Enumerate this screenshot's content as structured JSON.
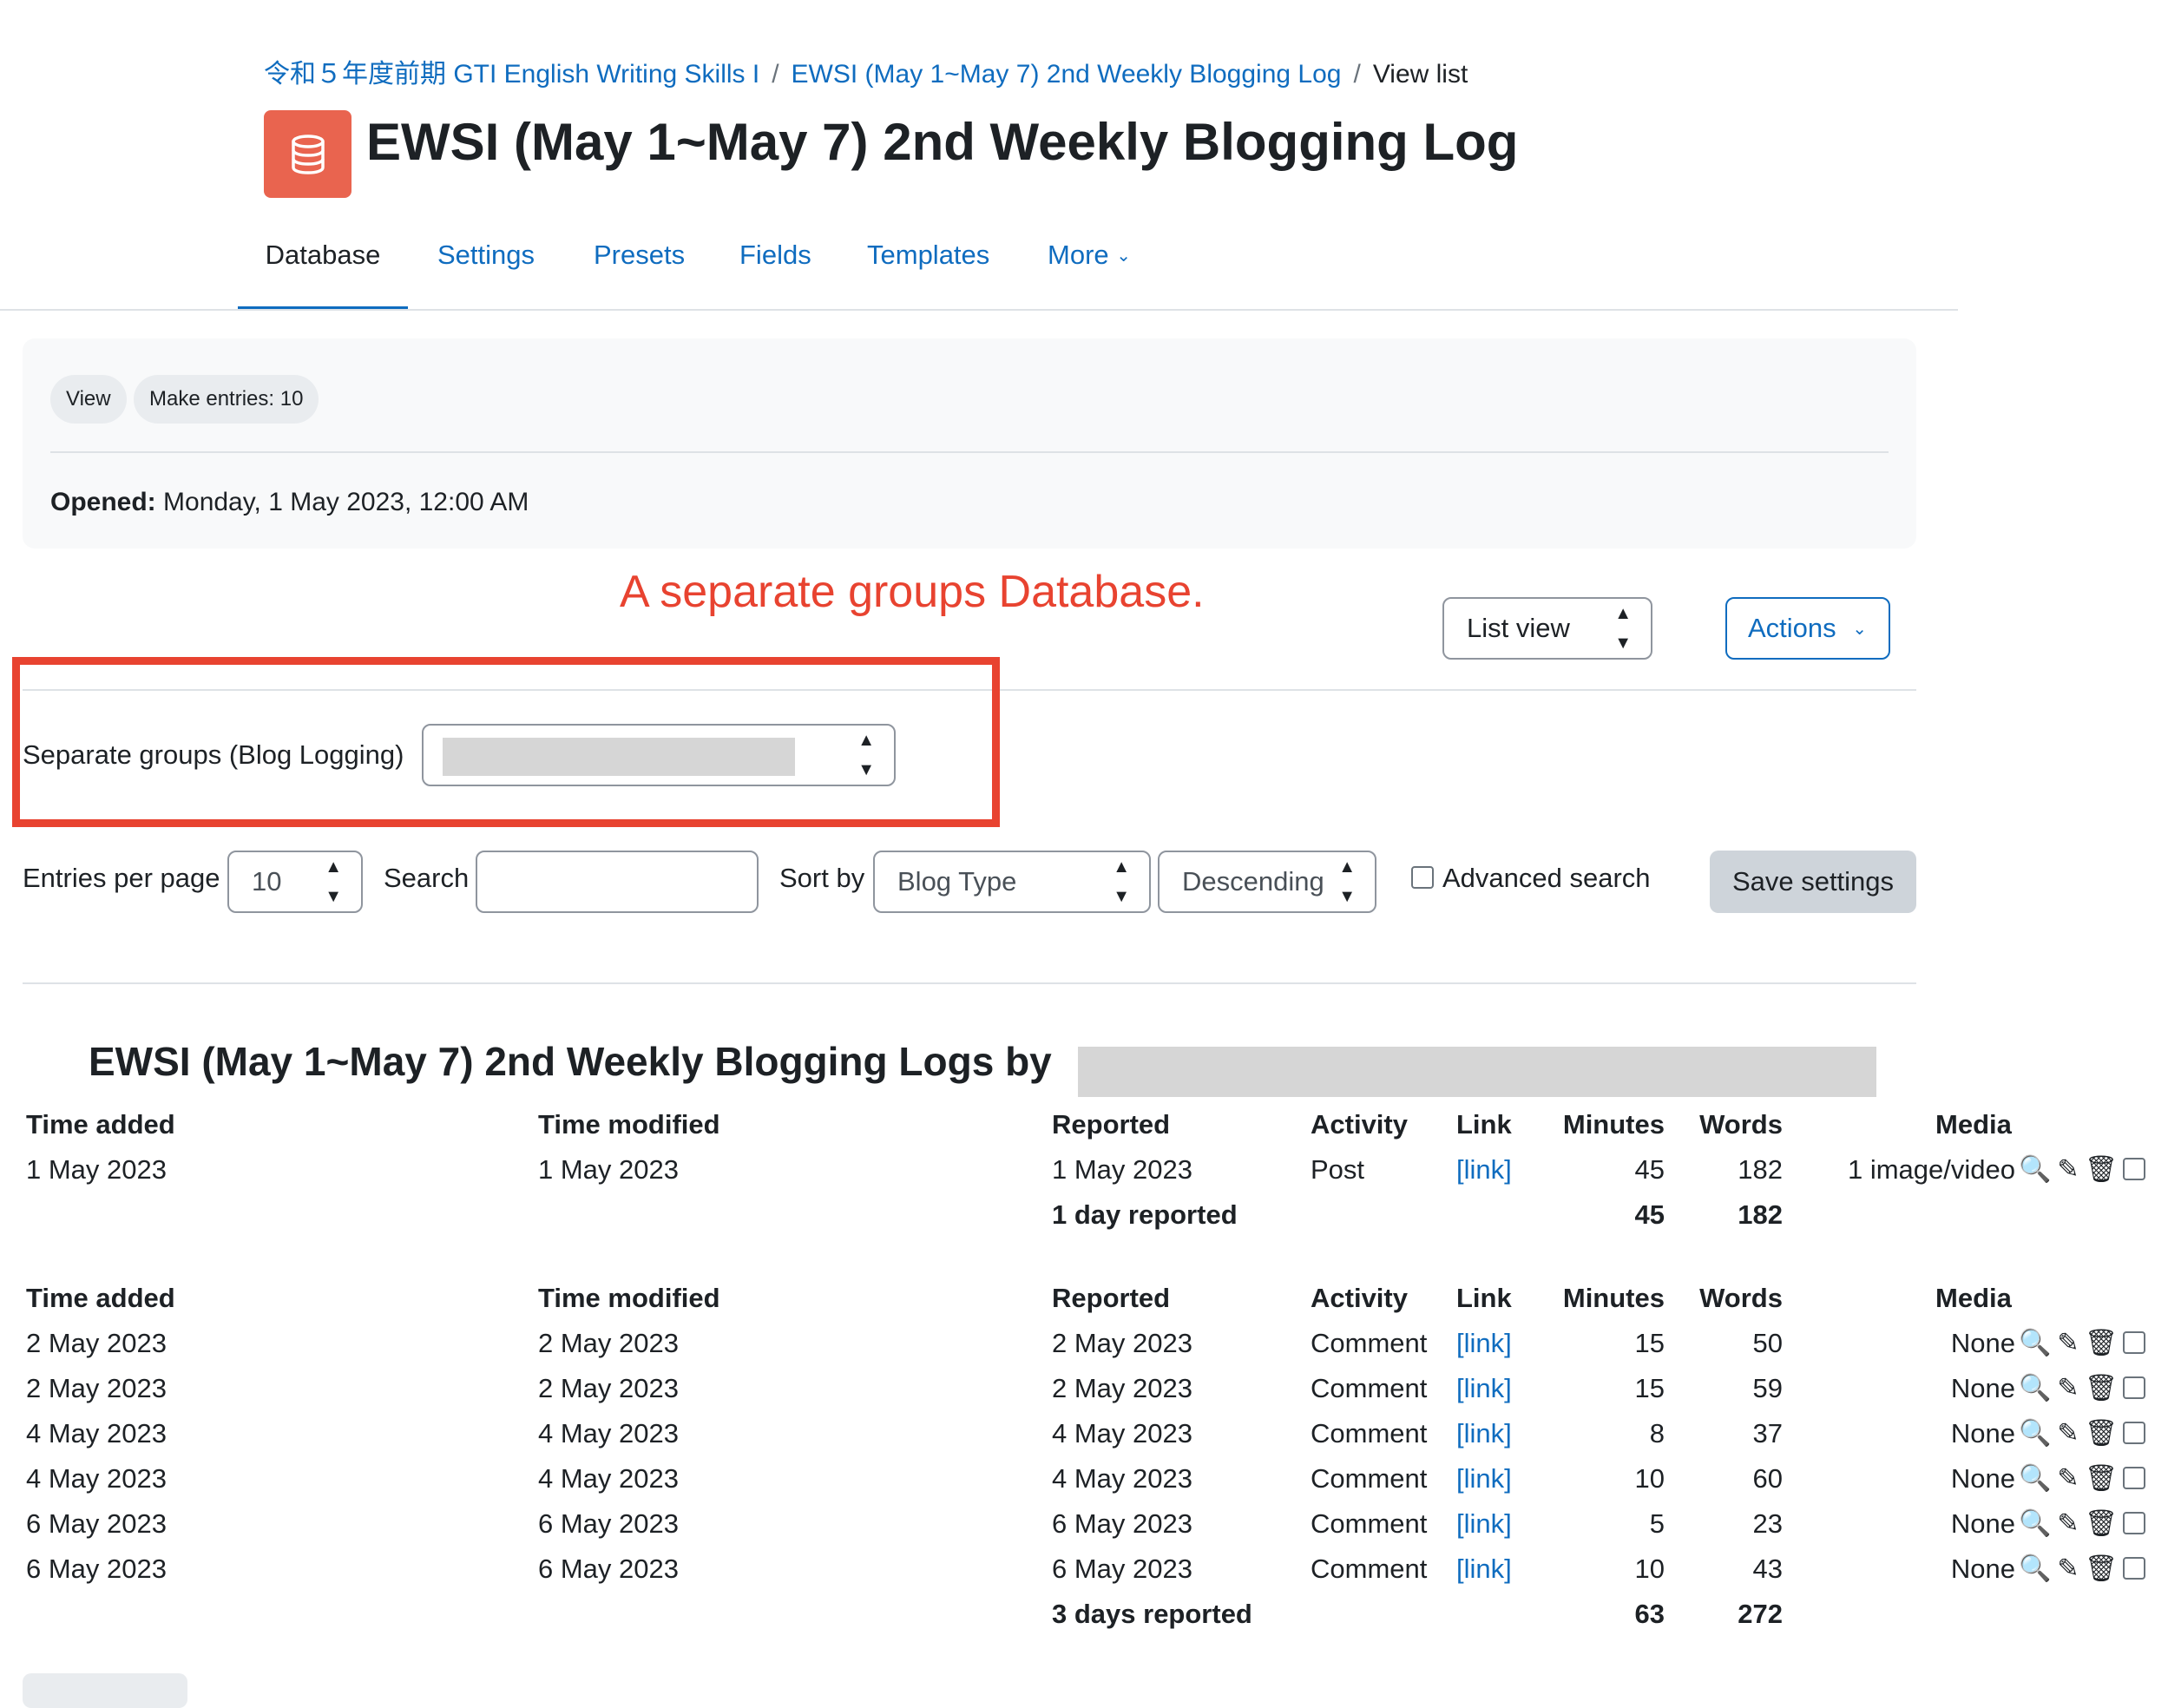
{
  "breadcrumb": {
    "course": "令和５年度前期 GTI English Writing Skills I",
    "activity": "EWSI (May 1~May 7) 2nd Weekly Blogging Log",
    "current": "View list",
    "separator": "/"
  },
  "header": {
    "title": "EWSI (May 1~May 7) 2nd Weekly Blogging Log",
    "icon": "database-icon",
    "icon_color": "#e9644f"
  },
  "nav": {
    "tabs": [
      "Database",
      "Settings",
      "Presets",
      "Fields",
      "Templates",
      "More"
    ],
    "active": "Database"
  },
  "info": {
    "pills": [
      "View",
      "Make entries: 10"
    ],
    "opened_label": "Opened:",
    "opened_value": "Monday, 1 May 2023, 12:00 AM"
  },
  "annotation": {
    "text": "A separate groups Database.",
    "color": "#e84330"
  },
  "view_select": {
    "value": "List view"
  },
  "actions_button": {
    "label": "Actions"
  },
  "groups": {
    "label": "Separate groups (Blog Logging)",
    "value": ""
  },
  "controls": {
    "entries_label": "Entries per page",
    "entries_value": "10",
    "search_label": "Search",
    "search_value": "",
    "sort_label": "Sort by",
    "sort_value": "Blog Type",
    "order_value": "Descending",
    "advanced_label": "Advanced search",
    "save_label": "Save settings"
  },
  "list": {
    "title": "EWSI (May 1~May 7) 2nd Weekly Blogging Logs by"
  },
  "table": {
    "headers": [
      "Time added",
      "Time modified",
      "Reported",
      "Activity",
      "Link",
      "Minutes",
      "Words",
      "Media"
    ],
    "groups": [
      {
        "rows": [
          {
            "added": "1 May 2023",
            "modified": "1 May 2023",
            "reported": "1 May 2023",
            "activity": "Post",
            "link": "[link]",
            "minutes": "45",
            "words": "182",
            "media": "1 image/video"
          }
        ],
        "total_label": "1 day reported",
        "total_minutes": "45",
        "total_words": "182"
      },
      {
        "rows": [
          {
            "added": "2 May 2023",
            "modified": "2 May 2023",
            "reported": "2 May 2023",
            "activity": "Comment",
            "link": "[link]",
            "minutes": "15",
            "words": "50",
            "media": "None"
          },
          {
            "added": "2 May 2023",
            "modified": "2 May 2023",
            "reported": "2 May 2023",
            "activity": "Comment",
            "link": "[link]",
            "minutes": "15",
            "words": "59",
            "media": "None"
          },
          {
            "added": "4 May 2023",
            "modified": "4 May 2023",
            "reported": "4 May 2023",
            "activity": "Comment",
            "link": "[link]",
            "minutes": "8",
            "words": "37",
            "media": "None"
          },
          {
            "added": "4 May 2023",
            "modified": "4 May 2023",
            "reported": "4 May 2023",
            "activity": "Comment",
            "link": "[link]",
            "minutes": "10",
            "words": "60",
            "media": "None"
          },
          {
            "added": "6 May 2023",
            "modified": "6 May 2023",
            "reported": "6 May 2023",
            "activity": "Comment",
            "link": "[link]",
            "minutes": "5",
            "words": "23",
            "media": "None"
          },
          {
            "added": "6 May 2023",
            "modified": "6 May 2023",
            "reported": "6 May 2023",
            "activity": "Comment",
            "link": "[link]",
            "minutes": "10",
            "words": "43",
            "media": "None"
          }
        ],
        "total_label": "3 days reported",
        "total_minutes": "63",
        "total_words": "272"
      }
    ],
    "row_icons": [
      "zoom-in-icon",
      "pencil-icon",
      "trash-icon"
    ]
  }
}
